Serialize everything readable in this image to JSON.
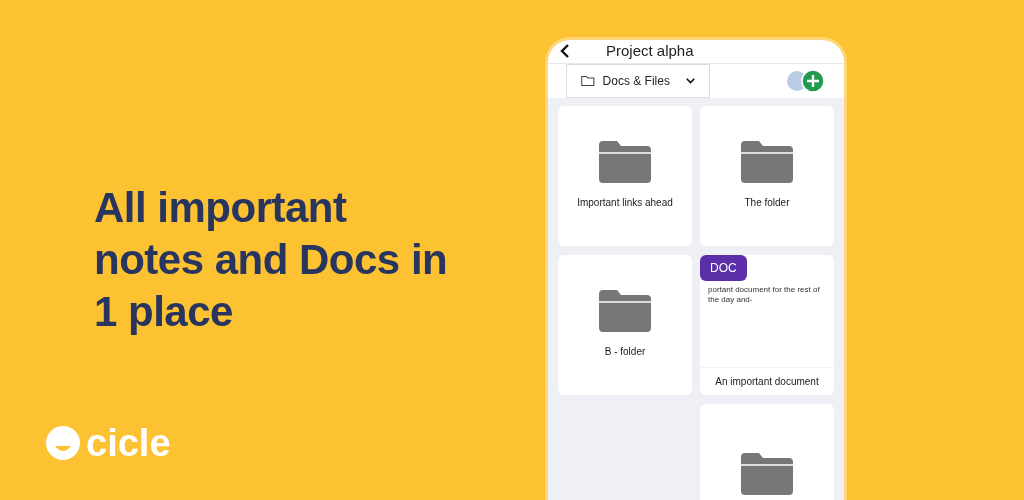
{
  "headline": "All important notes and Docs in 1 place",
  "brand": {
    "name": "cicle"
  },
  "phone": {
    "title": "Project alpha",
    "section_dropdown": {
      "label": "Docs & Files"
    },
    "columns": [
      {
        "items": [
          {
            "kind": "folder",
            "label": "Important links ahead"
          },
          {
            "kind": "folder",
            "label": "B - folder"
          }
        ]
      },
      {
        "items": [
          {
            "kind": "folder",
            "label": "The folder"
          },
          {
            "kind": "doc",
            "badge": "DOC",
            "preview": "portant document for the rest of the day and-",
            "label": "An important document"
          },
          {
            "kind": "folder"
          }
        ]
      }
    ]
  }
}
